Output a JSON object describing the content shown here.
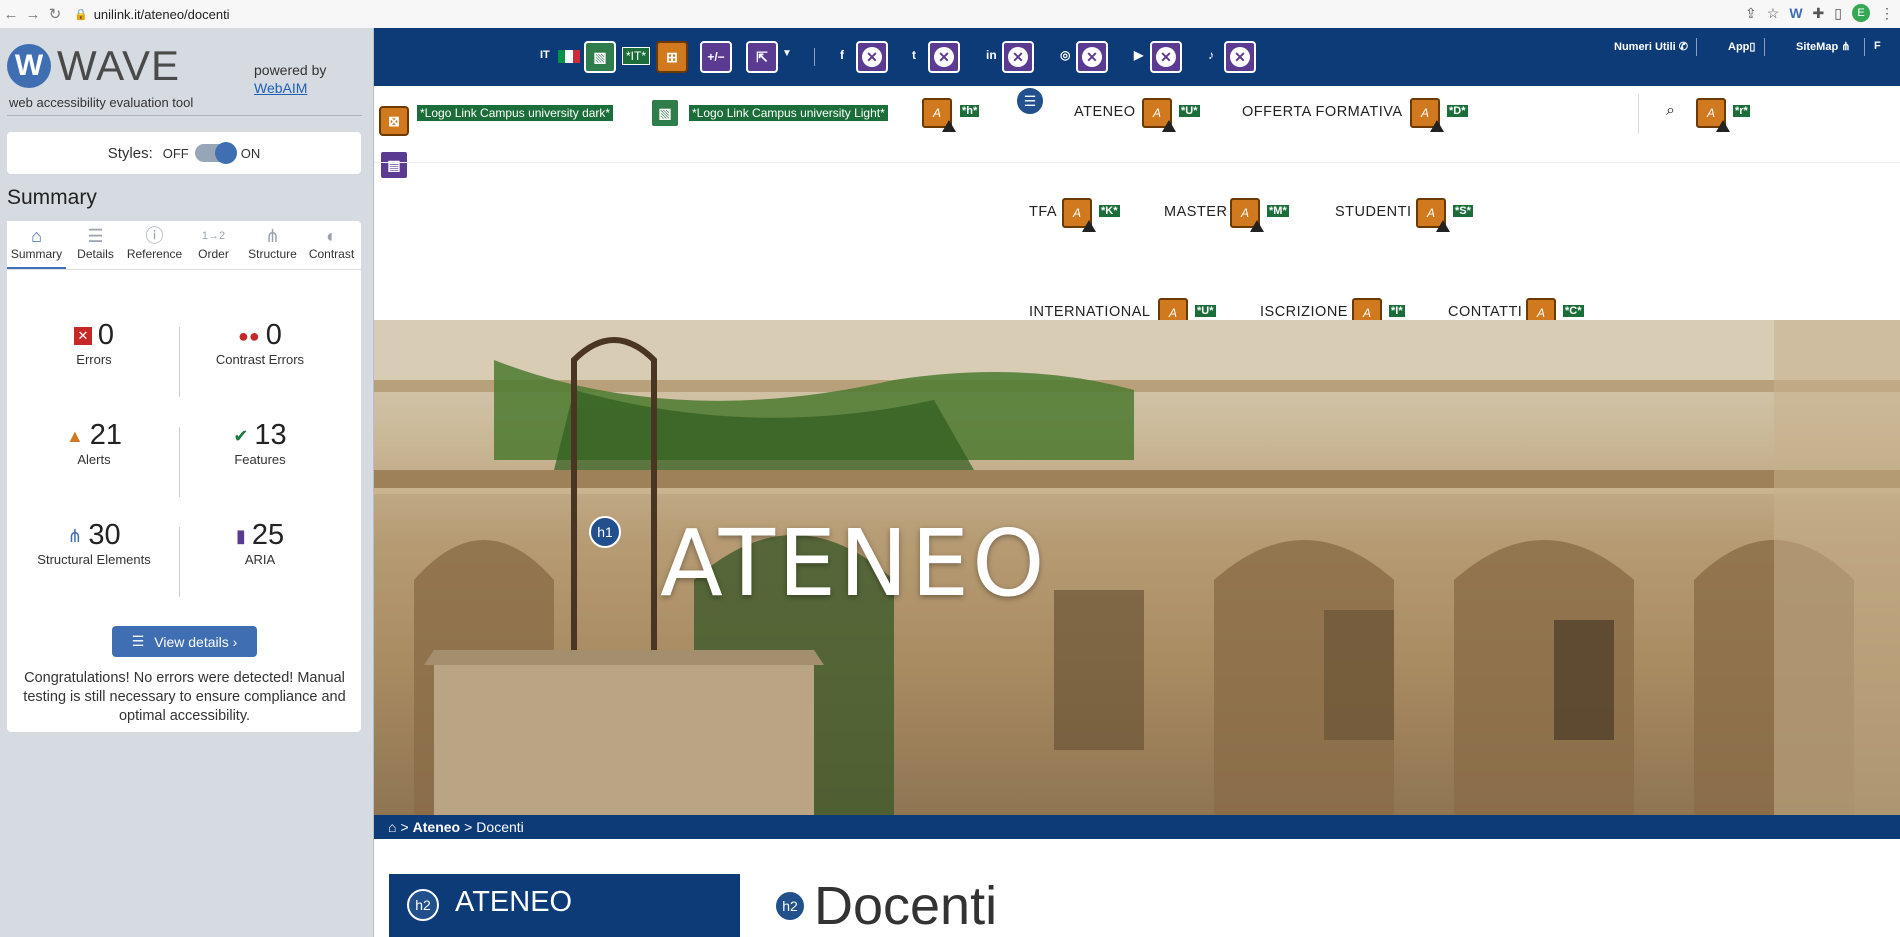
{
  "browser": {
    "url": "unilink.it/ateneo/docenti",
    "avatar_letter": "E"
  },
  "wave": {
    "brand": "WAVE",
    "tagline": "web accessibility evaluation tool",
    "powered_by": "powered by",
    "webaim": "WebAIM",
    "styles_label": "Styles:",
    "off": "OFF",
    "on": "ON",
    "summary_title": "Summary",
    "tabs": [
      {
        "label": "Summary",
        "icon": "home-icon"
      },
      {
        "label": "Details",
        "icon": "list-icon"
      },
      {
        "label": "Reference",
        "icon": "info-icon"
      },
      {
        "label": "Order",
        "icon": "order-icon"
      },
      {
        "label": "Structure",
        "icon": "structure-icon"
      },
      {
        "label": "Contrast",
        "icon": "contrast-icon"
      }
    ],
    "stats": {
      "errors": {
        "value": "0",
        "label": "Errors"
      },
      "contrast_errors": {
        "value": "0",
        "label": "Contrast Errors"
      },
      "alerts": {
        "value": "21",
        "label": "Alerts"
      },
      "features": {
        "value": "13",
        "label": "Features"
      },
      "structural": {
        "value": "30",
        "label": "Structural Elements"
      },
      "aria": {
        "value": "25",
        "label": "ARIA"
      }
    },
    "view_details": "View details ›",
    "congrats": "Congratulations! No errors were detected! Manual testing is still necessary to ensure compliance and optimal accessibility."
  },
  "site": {
    "lang": "IT",
    "lang_label": "*IT*",
    "toplinks": [
      "Numeri Utili",
      "App",
      "SiteMap",
      "F"
    ],
    "logo_dark": "*Logo Link Campus university dark*",
    "logo_light": "*Logo Link Campus university Light*",
    "accesskey_h": "*h*",
    "nav": [
      {
        "label": "ATENEO",
        "key": "*U*"
      },
      {
        "label": "OFFERTA FORMATIVA",
        "key": "*D*"
      },
      {
        "label": "TFA",
        "key": "*K*"
      },
      {
        "label": "MASTER",
        "key": "*M*"
      },
      {
        "label": "STUDENTI",
        "key": "*S*"
      },
      {
        "label": "INTERNATIONAL",
        "key": "*U*"
      },
      {
        "label": "ISCRIZIONE",
        "key": "*I*"
      },
      {
        "label": "CONTATTI",
        "key": "*C*"
      }
    ],
    "search_key": "*r*",
    "hero_title": "ATENEO",
    "breadcrumb": {
      "level1": "Ateneo",
      "level2": "Docenti",
      "sep": ">"
    },
    "sidebar_heading": "ATENEO",
    "page_heading": "Docenti",
    "h1": "h1",
    "h2": "h2",
    "icon_contrast": "+/−"
  },
  "colors": {
    "site_blue": "#0d3b77",
    "wave_blue": "#3f6fb2",
    "alert_orange": "#d0791e",
    "feature_green": "#1b6e3a",
    "aria_purple": "#5b3a92"
  }
}
